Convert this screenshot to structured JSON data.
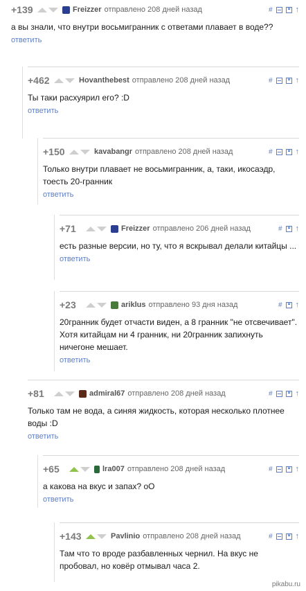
{
  "comments": [
    {
      "rating": "+139",
      "author": "Freizzer",
      "avatar_color": "#2c3e8f",
      "sent": "отправлено 208 дней назад",
      "text": "а вы знали, что внутри восьмигранник с ответами плавает в воде??",
      "reply": "ответить",
      "upvote_active": false,
      "tools": [
        "#",
        "minus",
        "save",
        "↑"
      ]
    },
    {
      "rating": "+462",
      "author": "Hovanthebest",
      "avatar_color": "",
      "sent": "отправлено 208 дней назад",
      "text": "Ты таки расхуярил его? :D",
      "reply": "ответить",
      "upvote_active": false,
      "tools": [
        "#",
        "minus",
        "save",
        "↑"
      ]
    },
    {
      "rating": "+150",
      "author": "kavabangr",
      "avatar_color": "",
      "sent": "отправлено 208 дней назад",
      "text": "Только внутри плавает не восьмигранник, а, таки, икосаэдр, тоесть 20-гранник",
      "reply": "ответить",
      "upvote_active": false,
      "tools": [
        "#",
        "minus",
        "save",
        "↑"
      ]
    },
    {
      "rating": "+71",
      "author": "Freizzer",
      "avatar_color": "#2c3e8f",
      "sent": "отправлено 206 дней назад",
      "text": "есть разные версии, но ту, что я вскрывал делали китайцы ...",
      "reply": "ответить",
      "upvote_active": false,
      "tools": [
        "#",
        "save",
        "↑"
      ]
    },
    {
      "rating": "+23",
      "author": "ariklus",
      "avatar_color": "#4a7a3a",
      "sent": "отправлено 93 дня назад",
      "text": "20гранник будет отчасти виден, а 8 гранник \"не отсвечивает\". Хотя китайцам ни 4 гранник, ни 20гранник запихнуть ничегоне мешает.",
      "reply": "ответить",
      "upvote_active": false,
      "tools": [
        "#",
        "save",
        "↑"
      ]
    },
    {
      "rating": "+81",
      "author": "admiral67",
      "avatar_color": "#5a2a1a",
      "sent": "отправлено 208 дней назад",
      "text": "Только там не вода, а синяя жидкость, которая несколько плотнее воды :D",
      "reply": "ответить",
      "upvote_active": false,
      "tools": [
        "#",
        "minus",
        "save",
        "↑"
      ]
    },
    {
      "rating": "+65",
      "author": "lra007",
      "avatar_color": "#2a6a3a",
      "sent": "отправлено 208 дней назад",
      "text": "а какова на вкус и запах? oO",
      "reply": "ответить",
      "upvote_active": true,
      "tools": [
        "#",
        "minus",
        "save",
        "↑"
      ]
    },
    {
      "rating": "+143",
      "author": "Pavlinio",
      "avatar_color": "",
      "sent": "отправлено 208 дней назад",
      "text": "Там что то вроде разбавленных чернил. На вкус не пробовал, но ковёр отмывал часа 2.",
      "reply": "",
      "upvote_active": true,
      "tools": [
        "#",
        "minus",
        "save",
        "↑"
      ]
    }
  ],
  "watermark": "pikabu.ru"
}
